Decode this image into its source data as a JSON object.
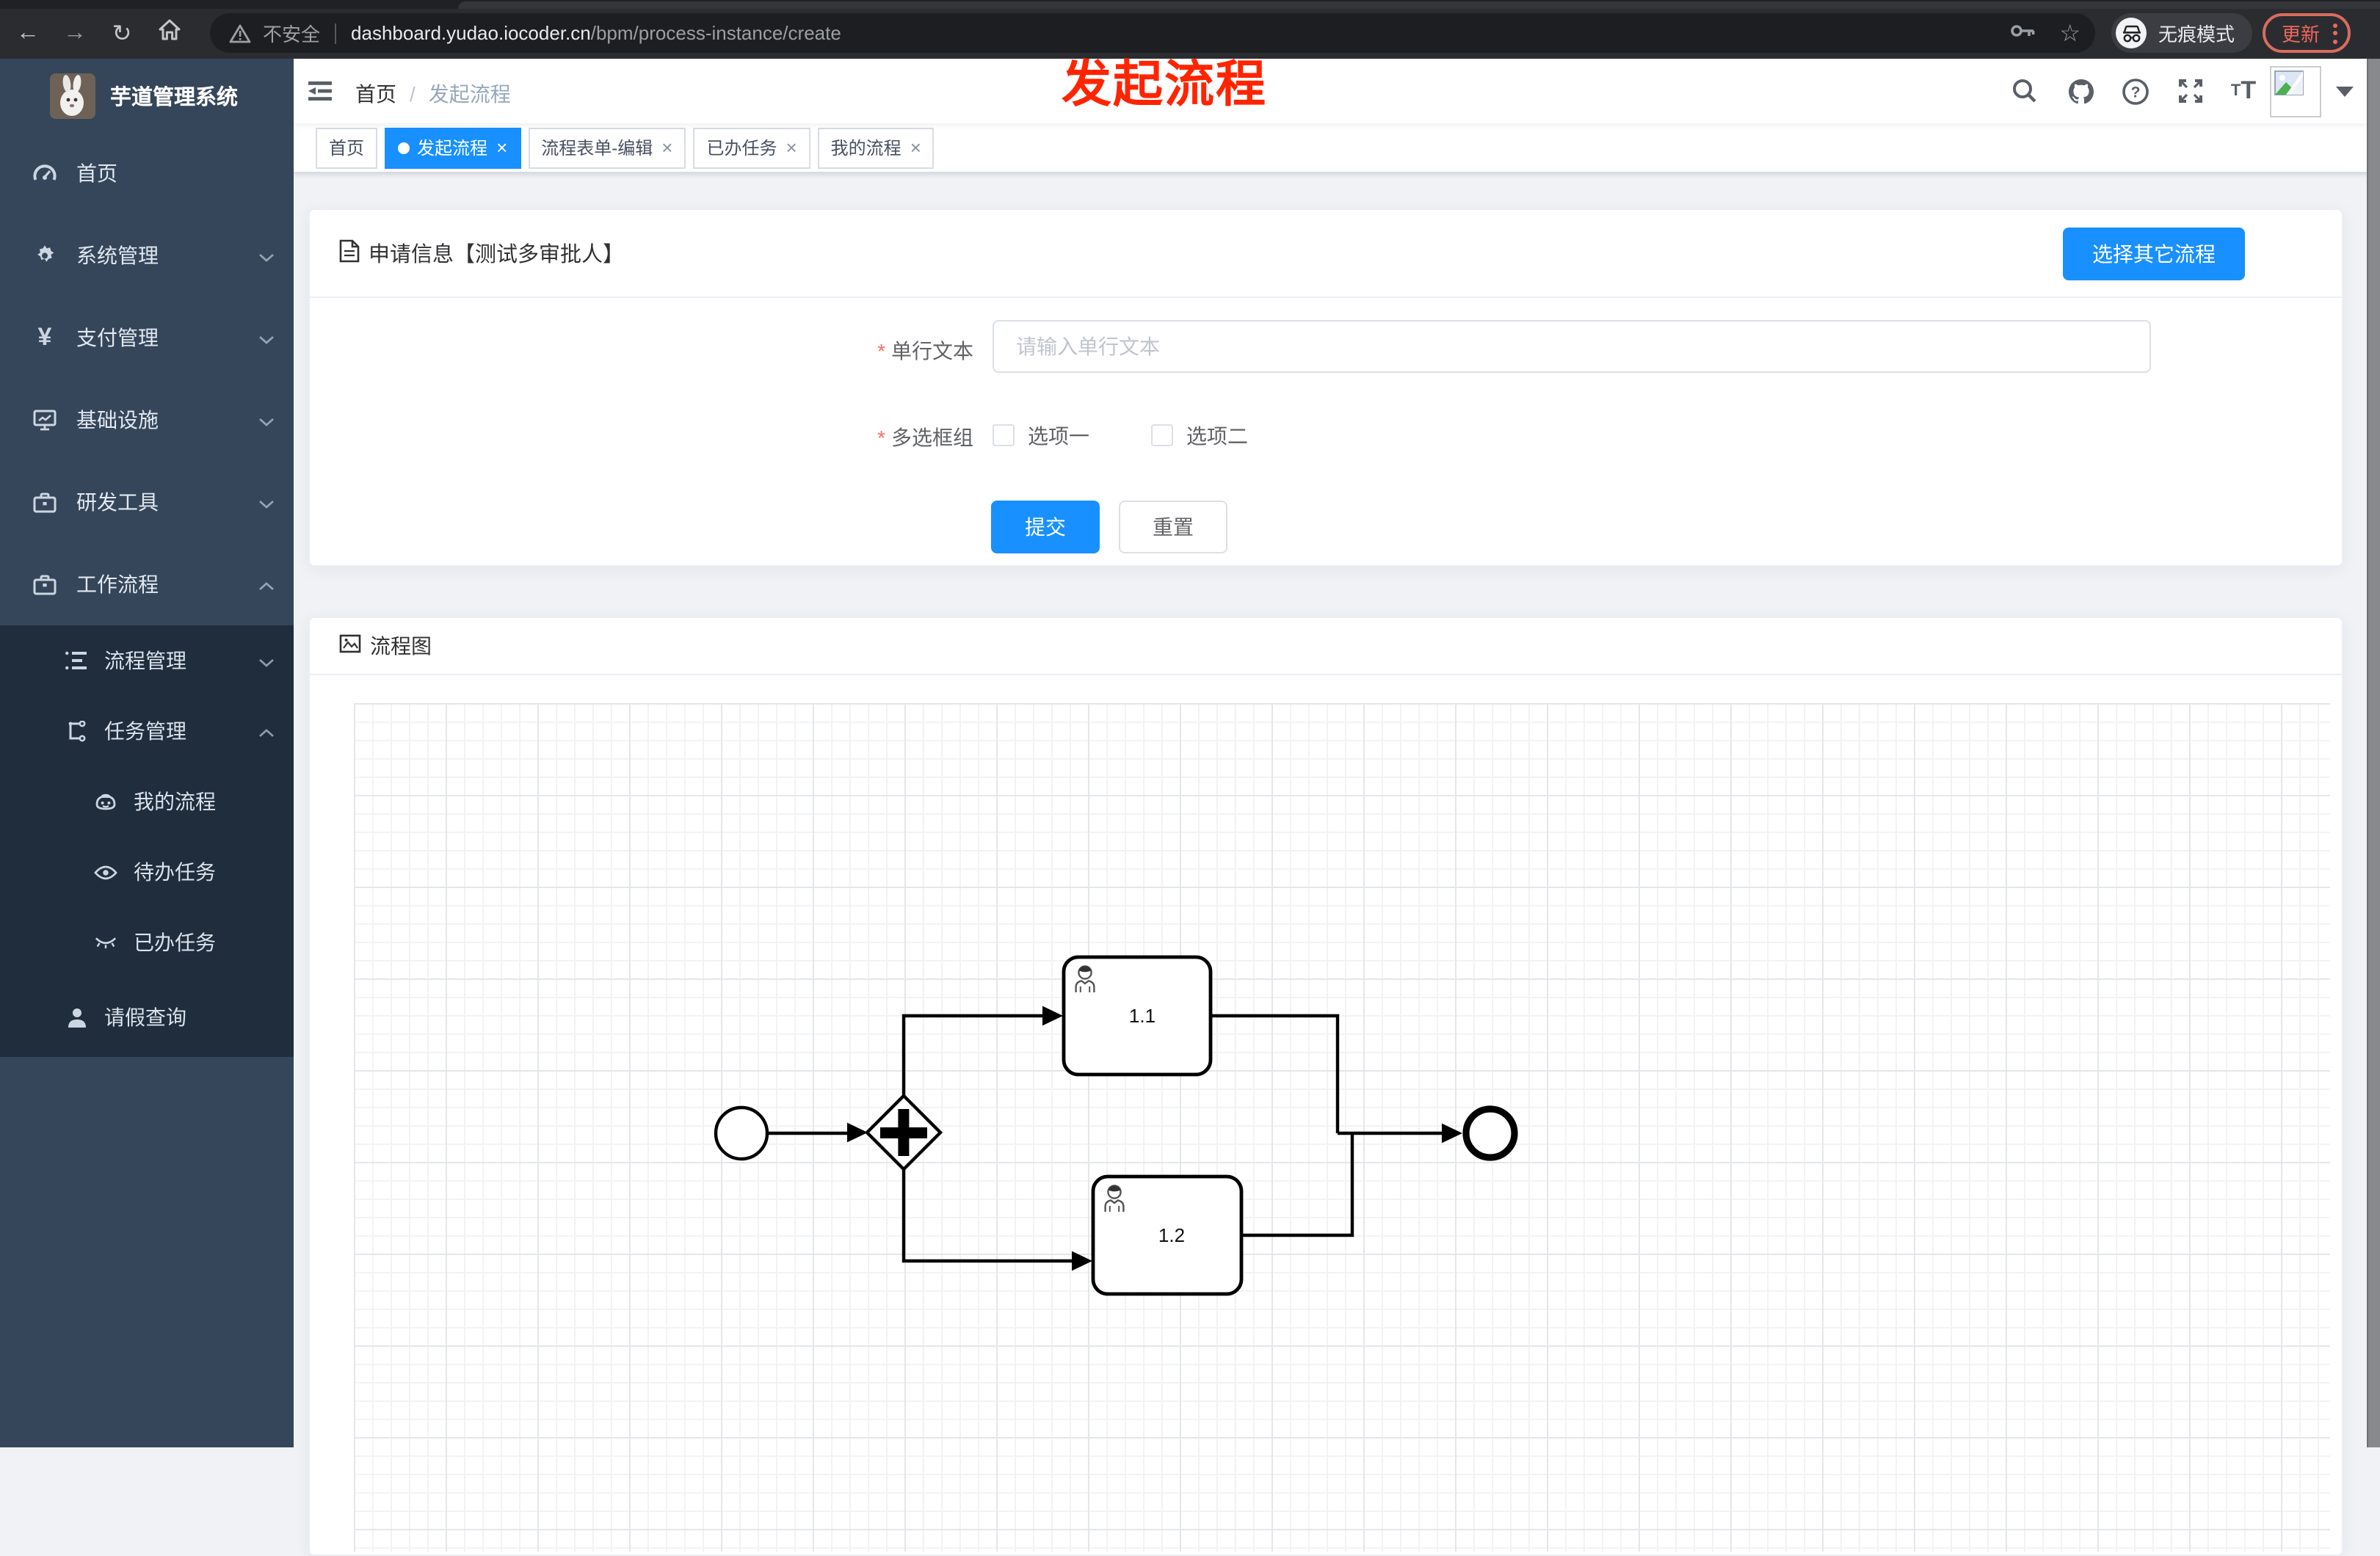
{
  "browser": {
    "security_label": "不安全",
    "url_domain": "dashboard.yudao.iocoder.cn",
    "url_path": "/bpm/process-instance/create",
    "incognito_label": "无痕模式",
    "update_label": "更新",
    "back_glyph": "←",
    "forward_glyph": "→",
    "reload_glyph": "↻",
    "star_glyph": "☆"
  },
  "annotation": {
    "text": "发起流程"
  },
  "sidebar": {
    "title": "芋道管理系统",
    "items": [
      {
        "label": "首页"
      },
      {
        "label": "系统管理"
      },
      {
        "label": "支付管理"
      },
      {
        "label": "基础设施"
      },
      {
        "label": "研发工具"
      },
      {
        "label": "工作流程"
      }
    ],
    "submenu": [
      {
        "label": "流程管理"
      },
      {
        "label": "任务管理"
      },
      {
        "label": "我的流程"
      },
      {
        "label": "待办任务"
      },
      {
        "label": "已办任务"
      },
      {
        "label": "请假查询"
      }
    ]
  },
  "header": {
    "breadcrumb": [
      "首页",
      "发起流程"
    ],
    "separator": "/",
    "font_icon_small": "T",
    "font_icon_big": "T",
    "help_glyph": "?"
  },
  "tabs": {
    "close_glyph": "×",
    "items": [
      {
        "label": "首页"
      },
      {
        "label": "发起流程"
      },
      {
        "label": "流程表单-编辑"
      },
      {
        "label": "已办任务"
      },
      {
        "label": "我的流程"
      }
    ]
  },
  "form_card": {
    "title": "申请信息【测试多审批人】",
    "switch_button": "选择其它流程",
    "field_text": {
      "label": "单行文本",
      "required_mark": "*",
      "placeholder": "请输入单行文本",
      "value": ""
    },
    "field_checkbox": {
      "label": "多选框组",
      "required_mark": "*",
      "options": [
        "选项一",
        "选项二"
      ]
    },
    "submit_label": "提交",
    "reset_label": "重置"
  },
  "diagram_card": {
    "title": "流程图",
    "task1_label": "1.1",
    "task2_label": "1.2"
  },
  "colors": {
    "accent": "#1890ff",
    "sidebar_bg": "#35465a",
    "submenu_bg": "#1f2d3d",
    "annotation_red": "#ff2400",
    "danger": "#f56c6c"
  }
}
